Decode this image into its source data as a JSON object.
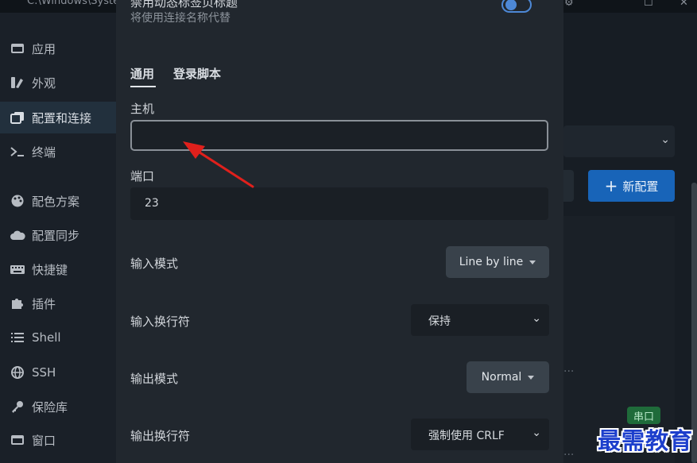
{
  "window": {
    "title_fragment": "C:\\Windows\\Syste"
  },
  "sidebar": {
    "items": [
      {
        "label": "应用",
        "icon": "window-icon"
      },
      {
        "label": "外观",
        "icon": "appearance-icon"
      },
      {
        "label": "配置和连接",
        "icon": "profiles-icon",
        "active": true
      },
      {
        "label": "终端",
        "icon": "terminal-icon"
      },
      {
        "label": "配色方案",
        "icon": "palette-icon"
      },
      {
        "label": "配置同步",
        "icon": "cloud-icon"
      },
      {
        "label": "快捷键",
        "icon": "keyboard-icon"
      },
      {
        "label": "插件",
        "icon": "puzzle-icon"
      },
      {
        "label": "Shell",
        "icon": "list-icon"
      },
      {
        "label": "SSH",
        "icon": "globe-icon"
      },
      {
        "label": "保险库",
        "icon": "key-icon"
      },
      {
        "label": "窗口",
        "icon": "window-icon"
      }
    ]
  },
  "background": {
    "new_config_label": "新配置",
    "badge": "串口",
    "dots": "···"
  },
  "modal": {
    "top_setting_title": "禁用动态标签页标题",
    "top_setting_subtitle": "将使用连接名称代替",
    "tabs": [
      {
        "label": "通用",
        "active": true
      },
      {
        "label": "登录脚本"
      }
    ],
    "host": {
      "label": "主机",
      "value": ""
    },
    "port": {
      "label": "端口",
      "value": "23"
    },
    "input_mode": {
      "label": "输入模式",
      "value": "Line by line"
    },
    "input_newline": {
      "label": "输入换行符",
      "value": "保持"
    },
    "output_mode": {
      "label": "输出模式",
      "value": "Normal"
    },
    "output_newline": {
      "label": "输出换行符",
      "value": "强制使用 CRLF"
    }
  },
  "watermark": "最需教育",
  "colors": {
    "accent": "#1864b8",
    "annotation_arrow": "#e0201c",
    "badge": "#1f6b3a"
  }
}
